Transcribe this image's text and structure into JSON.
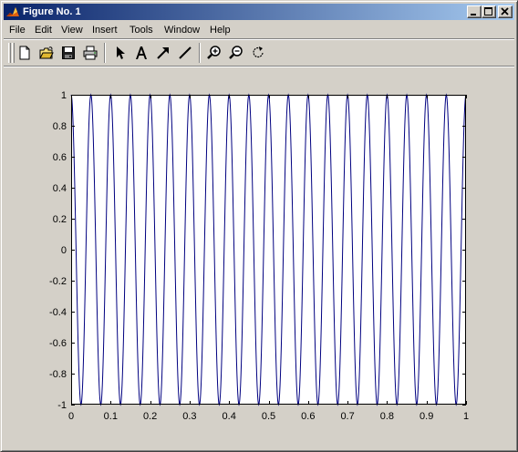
{
  "window": {
    "title": "Figure No. 1",
    "controls": {
      "minimize": "minimize-icon",
      "maximize": "maximize-icon",
      "close": "close-icon"
    }
  },
  "menubar": {
    "items": [
      "File",
      "Edit",
      "View",
      "Insert",
      "Tools",
      "Window",
      "Help"
    ]
  },
  "toolbar": {
    "buttons": [
      {
        "name": "new-figure",
        "icon": "new-document-icon"
      },
      {
        "name": "open-file",
        "icon": "open-folder-icon"
      },
      {
        "name": "save",
        "icon": "save-icon"
      },
      {
        "name": "print",
        "icon": "print-icon"
      },
      {
        "name": "edit-plot",
        "icon": "arrow-pointer-icon"
      },
      {
        "name": "insert-text",
        "icon": "text-a-icon"
      },
      {
        "name": "insert-arrow",
        "icon": "diagonal-arrow-icon"
      },
      {
        "name": "insert-line",
        "icon": "diagonal-line-icon"
      },
      {
        "name": "zoom-in",
        "icon": "zoom-in-icon"
      },
      {
        "name": "zoom-out",
        "icon": "zoom-out-icon"
      },
      {
        "name": "rotate-3d",
        "icon": "rotate-icon"
      }
    ]
  },
  "colors": {
    "line": "#000080",
    "axes_background": "#ffffff",
    "figure_background": "#d4d0c8"
  },
  "chart_data": {
    "type": "line",
    "title": "",
    "xlabel": "",
    "ylabel": "",
    "xlim": [
      0,
      1
    ],
    "ylim": [
      -1,
      1
    ],
    "grid": false,
    "xticks": [
      0,
      0.1,
      0.2,
      0.3,
      0.4,
      0.5,
      0.6,
      0.7,
      0.8,
      0.9,
      1
    ],
    "xtick_labels": [
      "0",
      "0.1",
      "0.2",
      "0.3",
      "0.4",
      "0.5",
      "0.6",
      "0.7",
      "0.8",
      "0.9",
      "1"
    ],
    "yticks": [
      -1,
      -0.8,
      -0.6,
      -0.4,
      -0.2,
      0,
      0.2,
      0.4,
      0.6,
      0.8,
      1
    ],
    "ytick_labels": [
      "-1",
      "-0.8",
      "-0.6",
      "-0.4",
      "-0.2",
      "0",
      "0.2",
      "0.4",
      "0.6",
      "0.8",
      "1"
    ],
    "series": [
      {
        "function": "cos",
        "frequency_cycles": 20,
        "amplitude": 1,
        "x_start": 0,
        "x_end": 1,
        "sample_step": 0.001
      }
    ]
  }
}
